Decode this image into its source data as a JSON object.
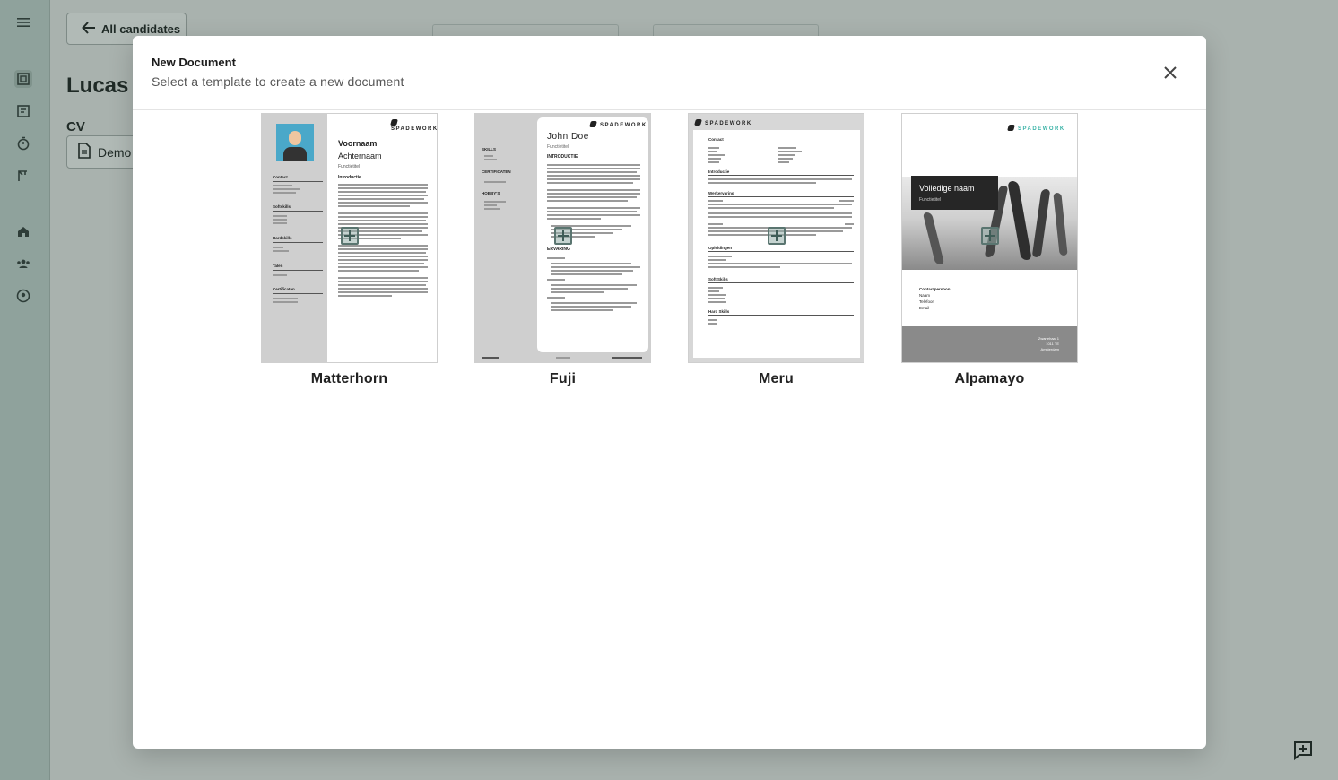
{
  "background": {
    "back_label": "All candidates",
    "candidate_name": "Lucas I",
    "cv_label": "CV",
    "document_label": "Demo"
  },
  "modal": {
    "title": "New Document",
    "subtitle": "Select a template to create a new document",
    "templates": [
      {
        "name": "Matterhorn",
        "preview": {
          "logo": "SPADEWORK",
          "first_name": "Voornaam",
          "last_name": "Achternaam",
          "role": "Functietitel",
          "intro": "Introductie",
          "contact": "Contact",
          "softskills": "Softskills",
          "hardskills": "Hardskills",
          "talen": "Talen",
          "certificaten": "Certificaten"
        }
      },
      {
        "name": "Fuji",
        "preview": {
          "logo": "SPADEWORK",
          "name": "John Doe",
          "role": "Functietitel",
          "intro": "INTRODUCTIE",
          "skills": "SKILLS",
          "certificaten": "CERTIFICATEN",
          "hobbys": "HOBBY'S",
          "ervaring": "ERVARING"
        }
      },
      {
        "name": "Meru",
        "preview": {
          "logo": "SPADEWORK",
          "contact": "Contact",
          "intro": "Introductie",
          "werkervaring": "Werkervaring",
          "opleidingen": "Opleidingen",
          "soft_skills": "Soft Skills",
          "hard_skills": "Hard Skills"
        }
      },
      {
        "name": "Alpamayo",
        "preview": {
          "logo": "SPADEWORK",
          "name": "Volledige naam",
          "role": "Functietitel",
          "contact_heading": "Contactpersoon",
          "contact_lines": [
            "Naam",
            "Telefoon",
            "Email"
          ],
          "address": [
            "Zwartehaal 1",
            "1011 TE",
            "Amsterdam"
          ]
        }
      }
    ]
  },
  "colors": {
    "overlay": "#a9b2ae",
    "sidebar": "#8fa29c",
    "accent_teal": "#3bb3a7"
  }
}
